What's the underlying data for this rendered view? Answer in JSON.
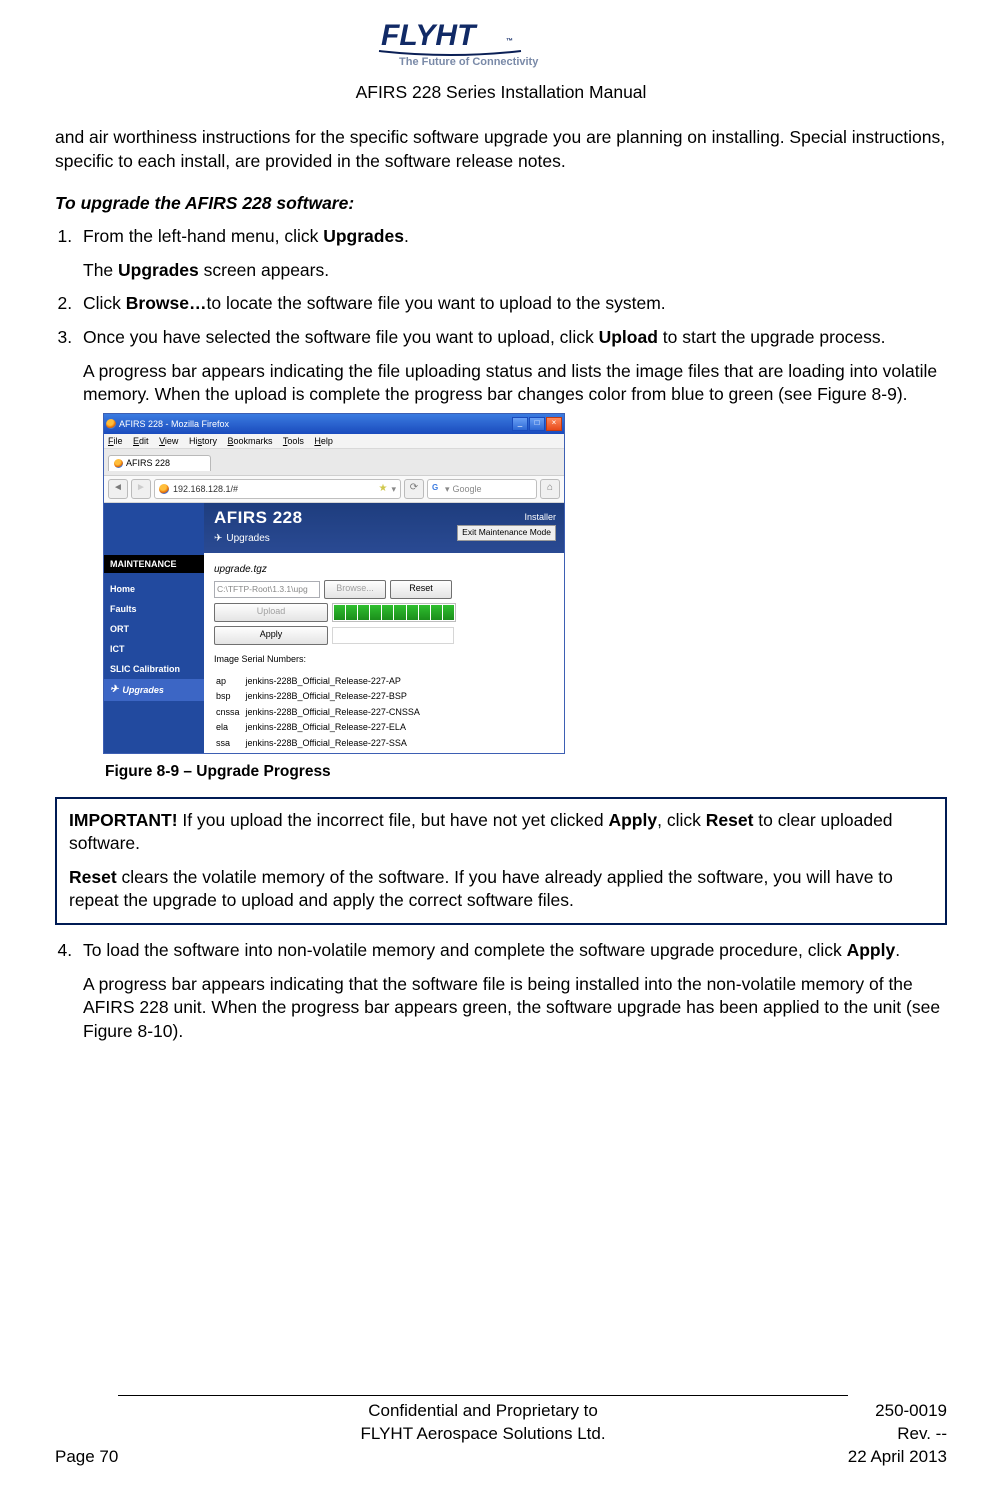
{
  "header": {
    "logo_main": "FLYHT",
    "logo_sub": "The Future of Connectivity",
    "manual_title": "AFIRS 228 Series Installation Manual"
  },
  "intro": "and air worthiness instructions for the specific software upgrade you are planning on installing. Special instructions, specific to each install, are provided in the software release notes.",
  "subhead": "To upgrade the AFIRS 228 software:",
  "steps": {
    "s1": {
      "pre": "From the left-hand menu, click ",
      "bold": "Upgrades",
      "post": ".",
      "sub_pre": "The ",
      "sub_bold": "Upgrades",
      "sub_post": " screen appears."
    },
    "s2": {
      "pre": "Click ",
      "bold": "Browse…",
      "post": "to locate the software file you want to upload to the system."
    },
    "s3": {
      "pre": "Once you have selected the software file you want to upload, click ",
      "bold": "Upload",
      "post": " to start the upgrade process.",
      "sub": "A progress bar appears indicating the file uploading status and lists the image files that are loading into volatile memory. When the upload is complete the progress bar changes color from blue to green (see Figure 8-9)."
    },
    "s4": {
      "pre": "To load the software into non-volatile memory and complete the software upgrade procedure, click ",
      "bold": "Apply",
      "post": ".",
      "sub": "A progress bar appears indicating that the software file is being installed into the non-volatile memory of the AFIRS 228 unit. When the progress bar appears green, the software upgrade has been applied to the unit (see Figure 8-10)."
    }
  },
  "screenshot": {
    "window_title": "AFIRS 228 - Mozilla Firefox",
    "menus": [
      "File",
      "Edit",
      "View",
      "History",
      "Bookmarks",
      "Tools",
      "Help"
    ],
    "tab": "AFIRS 228",
    "address": "192.168.128.1/#",
    "search_placeholder": "Google",
    "brand": "AFIRS 228",
    "brand_sub": "Upgrades",
    "installer_label": "Installer",
    "exit_btn": "Exit Maintenance Mode",
    "side_cat": "MAINTENANCE",
    "side_items": [
      "Home",
      "Faults",
      "ORT",
      "ICT",
      "SLIC Calibration"
    ],
    "side_sel": "Upgrades",
    "file_name": "upgrade.tgz",
    "file_path": "C:\\TFTP-Root\\1.3.1\\upg",
    "btn_browse": "Browse...",
    "btn_reset": "Reset",
    "btn_upload": "Upload",
    "btn_apply": "Apply",
    "serials_header": "Image Serial Numbers:",
    "serials": [
      {
        "k": "ap",
        "v": "jenkins-228B_Official_Release-227-AP"
      },
      {
        "k": "bsp",
        "v": "jenkins-228B_Official_Release-227-BSP"
      },
      {
        "k": "cnssa",
        "v": "jenkins-228B_Official_Release-227-CNSSA"
      },
      {
        "k": "ela",
        "v": "jenkins-228B_Official_Release-227-ELA"
      },
      {
        "k": "ssa",
        "v": "jenkins-228B_Official_Release-227-SSA"
      }
    ]
  },
  "figure_caption": "Figure 8-9 – Upgrade Progress",
  "important": {
    "p1_lead": "IMPORTANT!",
    "p1_mid1": " If you upload the incorrect file, but have not yet clicked ",
    "p1_b1": "Apply",
    "p1_mid2": ", click ",
    "p1_b2": "Reset",
    "p1_end": " to clear uploaded software.",
    "p2_b": "Reset",
    "p2_rest": " clears the volatile memory of the software. If you have already applied the software, you will have to repeat the upgrade to upload and apply the correct software files."
  },
  "footer": {
    "page": "Page 70",
    "conf1": "Confidential and Proprietary to",
    "conf2": "FLYHT Aerospace Solutions Ltd.",
    "docnum": "250-0019",
    "rev": "Rev. --",
    "date": "22 April 2013"
  }
}
